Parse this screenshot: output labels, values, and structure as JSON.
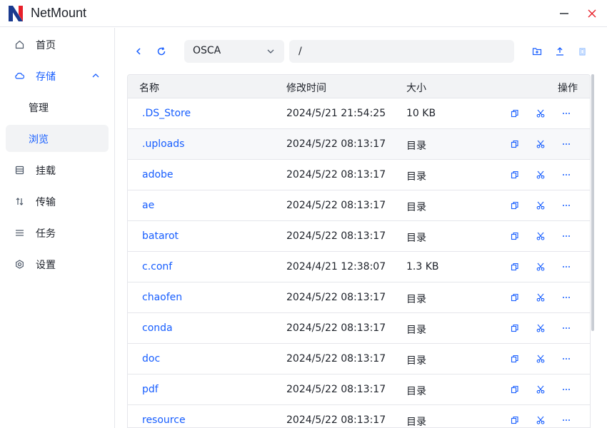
{
  "app": {
    "title": "NetMount"
  },
  "sidebar": {
    "items": [
      {
        "label": "首页",
        "icon": "home-icon"
      },
      {
        "label": "存储",
        "icon": "cloud-icon",
        "expanded": true
      },
      {
        "label": "管理"
      },
      {
        "label": "浏览",
        "selected": true
      },
      {
        "label": "挂载",
        "icon": "storage-icon"
      },
      {
        "label": "传输",
        "icon": "transfer-icon"
      },
      {
        "label": "任务",
        "icon": "list-icon"
      },
      {
        "label": "设置",
        "icon": "gear-icon"
      }
    ]
  },
  "toolbar": {
    "drive": "OSCA",
    "path": "/"
  },
  "table": {
    "headers": {
      "name": "名称",
      "time": "修改时间",
      "size": "大小",
      "actions": "操作"
    },
    "rows": [
      {
        "name": ".DS_Store",
        "time": "2024/5/21 21:54:25",
        "size": "10 KB"
      },
      {
        "name": ".uploads",
        "time": "2024/5/22 08:13:17",
        "size": "目录"
      },
      {
        "name": "adobe",
        "time": "2024/5/22 08:13:17",
        "size": "目录"
      },
      {
        "name": "ae",
        "time": "2024/5/22 08:13:17",
        "size": "目录"
      },
      {
        "name": "batarot",
        "time": "2024/5/22 08:13:17",
        "size": "目录"
      },
      {
        "name": "c.conf",
        "time": "2024/4/21 12:38:07",
        "size": "1.3 KB"
      },
      {
        "name": "chaofen",
        "time": "2024/5/22 08:13:17",
        "size": "目录"
      },
      {
        "name": "conda",
        "time": "2024/5/22 08:13:17",
        "size": "目录"
      },
      {
        "name": "doc",
        "time": "2024/5/22 08:13:17",
        "size": "目录"
      },
      {
        "name": "pdf",
        "time": "2024/5/22 08:13:17",
        "size": "目录"
      },
      {
        "name": "resource",
        "time": "2024/5/22 08:13:17",
        "size": "目录"
      }
    ]
  },
  "colors": {
    "accent": "#165dff",
    "logo_blue": "#1a3a8f",
    "logo_red": "#e8202a",
    "close": "#e8202a"
  }
}
